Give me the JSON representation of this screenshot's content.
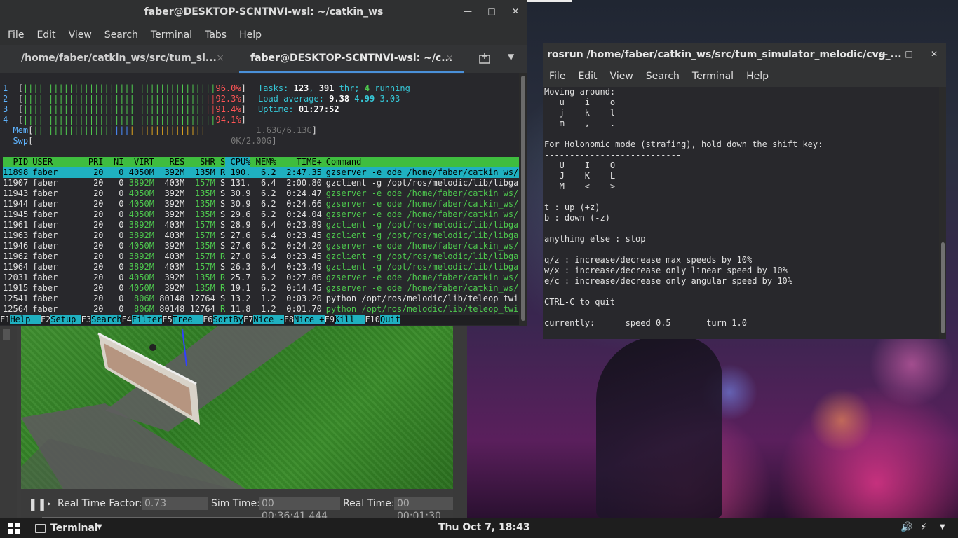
{
  "colors": {
    "accent_tab": "#4a90d9",
    "htop_green": "#4ec94e",
    "htop_cyan": "#1fb0c0",
    "htop_red": "#e04848"
  },
  "terminal1": {
    "title": "faber@DESKTOP-SCNTNVI-wsl: ~/catkin_ws",
    "menu": [
      "File",
      "Edit",
      "View",
      "Search",
      "Terminal",
      "Tabs",
      "Help"
    ],
    "tabs": [
      {
        "label": "/home/faber/catkin_ws/src/tum_si...",
        "close": "×"
      },
      {
        "label": "faber@DESKTOP-SCNTNVI-wsl: ~/c...",
        "close": "×"
      }
    ],
    "new_tab_icon": "new-tab-icon",
    "htop": {
      "cpus": [
        {
          "id": "1",
          "bars": "||||||||||||||||||||||||||||||||||||||",
          "pct": "96.0%"
        },
        {
          "id": "2",
          "bars": "||||||||||||||||||||||||||||||||||||",
          "pct": "92.3%"
        },
        {
          "id": "3",
          "bars": "||||||||||||||||||||||||||||||||||||",
          "pct": "91.4%"
        },
        {
          "id": "4",
          "bars": "||||||||||||||||||||||||||||||||||||||",
          "pct": "94.1%"
        }
      ],
      "mem": {
        "label": "Mem",
        "bars": "||||||||||||||||||||||||||||||||||||||",
        "value": "1.63G/6.13G"
      },
      "swp": {
        "label": "Swp",
        "value": "0K/2.00G"
      },
      "tasks": {
        "label": "Tasks:",
        "count": "123",
        "sep": ", ",
        "threads": "391",
        "thr_label": " thr; ",
        "running": "4",
        "running_label": " running"
      },
      "load": {
        "label": "Load average:",
        "v1": "9.38",
        "v2": "4.99",
        "v3": "3.03"
      },
      "uptime": {
        "label": "Uptime:",
        "value": "01:27:52"
      },
      "columns": [
        "PID",
        "USER",
        "PRI",
        "NI",
        "VIRT",
        "RES",
        "SHR",
        "S",
        "CPU%",
        "MEM%",
        "TIME+",
        "Command"
      ],
      "processes": [
        {
          "pid": "11898",
          "user": "faber",
          "pri": "20",
          "ni": "0",
          "virt": "4050M",
          "res": "392M",
          "shr": "135M",
          "s": "R",
          "cpu": "190.",
          "mem": "6.2",
          "time": "2:47.35",
          "cmd": "gzserver -e ode /home/faber/catkin_ws/src/"
        },
        {
          "pid": "11907",
          "user": "faber",
          "pri": "20",
          "ni": "0",
          "virt": "3892M",
          "res": "403M",
          "shr": "157M",
          "s": "S",
          "cpu": "131.",
          "mem": "6.4",
          "time": "2:00.80",
          "cmd": "gzclient -g /opt/ros/melodic/lib/libgazebo"
        },
        {
          "pid": "11943",
          "user": "faber",
          "pri": "20",
          "ni": "0",
          "virt": "4050M",
          "res": "392M",
          "shr": "135M",
          "s": "S",
          "cpu": "30.9",
          "mem": "6.2",
          "time": "0:24.47",
          "cmd": "gzserver -e ode /home/faber/catkin_ws/src/"
        },
        {
          "pid": "11944",
          "user": "faber",
          "pri": "20",
          "ni": "0",
          "virt": "4050M",
          "res": "392M",
          "shr": "135M",
          "s": "S",
          "cpu": "30.9",
          "mem": "6.2",
          "time": "0:24.66",
          "cmd": "gzserver -e ode /home/faber/catkin_ws/src/"
        },
        {
          "pid": "11945",
          "user": "faber",
          "pri": "20",
          "ni": "0",
          "virt": "4050M",
          "res": "392M",
          "shr": "135M",
          "s": "S",
          "cpu": "29.6",
          "mem": "6.2",
          "time": "0:24.04",
          "cmd": "gzserver -e ode /home/faber/catkin_ws/src/"
        },
        {
          "pid": "11961",
          "user": "faber",
          "pri": "20",
          "ni": "0",
          "virt": "3892M",
          "res": "403M",
          "shr": "157M",
          "s": "S",
          "cpu": "28.9",
          "mem": "6.4",
          "time": "0:23.89",
          "cmd": "gzclient -g /opt/ros/melodic/lib/libgazebo"
        },
        {
          "pid": "11963",
          "user": "faber",
          "pri": "20",
          "ni": "0",
          "virt": "3892M",
          "res": "403M",
          "shr": "157M",
          "s": "S",
          "cpu": "27.6",
          "mem": "6.4",
          "time": "0:23.45",
          "cmd": "gzclient -g /opt/ros/melodic/lib/libgazebo"
        },
        {
          "pid": "11946",
          "user": "faber",
          "pri": "20",
          "ni": "0",
          "virt": "4050M",
          "res": "392M",
          "shr": "135M",
          "s": "S",
          "cpu": "27.6",
          "mem": "6.2",
          "time": "0:24.20",
          "cmd": "gzserver -e ode /home/faber/catkin_ws/src/"
        },
        {
          "pid": "11962",
          "user": "faber",
          "pri": "20",
          "ni": "0",
          "virt": "3892M",
          "res": "403M",
          "shr": "157M",
          "s": "R",
          "cpu": "27.0",
          "mem": "6.4",
          "time": "0:23.45",
          "cmd": "gzclient -g /opt/ros/melodic/lib/libgazebo"
        },
        {
          "pid": "11964",
          "user": "faber",
          "pri": "20",
          "ni": "0",
          "virt": "3892M",
          "res": "403M",
          "shr": "157M",
          "s": "S",
          "cpu": "26.3",
          "mem": "6.4",
          "time": "0:23.49",
          "cmd": "gzclient -g /opt/ros/melodic/lib/libgazebo"
        },
        {
          "pid": "12031",
          "user": "faber",
          "pri": "20",
          "ni": "0",
          "virt": "4050M",
          "res": "392M",
          "shr": "135M",
          "s": "R",
          "cpu": "25.7",
          "mem": "6.2",
          "time": "0:27.86",
          "cmd": "gzserver -e ode /home/faber/catkin_ws/src/"
        },
        {
          "pid": "11915",
          "user": "faber",
          "pri": "20",
          "ni": "0",
          "virt": "4050M",
          "res": "392M",
          "shr": "135M",
          "s": "R",
          "cpu": "19.1",
          "mem": "6.2",
          "time": "0:14.45",
          "cmd": "gzserver -e ode /home/faber/catkin_ws/src/"
        },
        {
          "pid": "12541",
          "user": "faber",
          "pri": "20",
          "ni": "0",
          "virt": "806M",
          "res": "80148",
          "shr": "12764",
          "s": "S",
          "cpu": "13.2",
          "mem": "1.2",
          "time": "0:03.20",
          "cmd": "python /opt/ros/melodic/lib/teleop_twist_k"
        },
        {
          "pid": "12564",
          "user": "faber",
          "pri": "20",
          "ni": "0",
          "virt": "806M",
          "res": "80148",
          "shr": "12764",
          "s": "R",
          "cpu": "11.8",
          "mem": "1.2",
          "time": "0:01.70",
          "cmd": "python /opt/ros/melodic/lib/teleop_twist_k"
        }
      ],
      "fkeys": [
        {
          "key": "F1",
          "label": "Help  "
        },
        {
          "key": "F2",
          "label": "Setup "
        },
        {
          "key": "F3",
          "label": "Search"
        },
        {
          "key": "F4",
          "label": "Filter"
        },
        {
          "key": "F5",
          "label": "Tree  "
        },
        {
          "key": "F6",
          "label": "SortBy"
        },
        {
          "key": "F7",
          "label": "Nice -"
        },
        {
          "key": "F8",
          "label": "Nice +"
        },
        {
          "key": "F9",
          "label": "Kill  "
        },
        {
          "key": "F10",
          "label": "Quit"
        }
      ]
    }
  },
  "gazebo": {
    "real_time_factor_label": "Real Time Factor:",
    "real_time_factor": "0.73",
    "sim_time_label": "Sim Time:",
    "sim_time": "00 00:36:41.444",
    "real_time_label": "Real Time:",
    "real_time": "00 00:01:30",
    "pause_icon": "pause-icon"
  },
  "terminal2": {
    "title": "rosrun  /home/faber/catkin_ws/src/tum_simulator_melodic/cvg_...",
    "menu": [
      "File",
      "Edit",
      "View",
      "Search",
      "Terminal",
      "Help"
    ],
    "lines": [
      "Moving around:",
      "   u    i    o",
      "   j    k    l",
      "   m    ,    .",
      "",
      "For Holonomic mode (strafing), hold down the shift key:",
      "---------------------------",
      "   U    I    O",
      "   J    K    L",
      "   M    <    >",
      "",
      "t : up (+z)",
      "b : down (-z)",
      "",
      "anything else : stop",
      "",
      "q/z : increase/decrease max speeds by 10%",
      "w/x : increase/decrease only linear speed by 10%",
      "e/c : increase/decrease only angular speed by 10%",
      "",
      "CTRL-C to quit",
      "",
      "currently:      speed 0.5       turn 1.0"
    ]
  },
  "taskbar": {
    "app_label": "Terminal",
    "clock": "Thu Oct  7, 18:43",
    "icons": [
      "windows-start-icon",
      "terminal-icon",
      "volume-icon",
      "battery-icon"
    ]
  }
}
